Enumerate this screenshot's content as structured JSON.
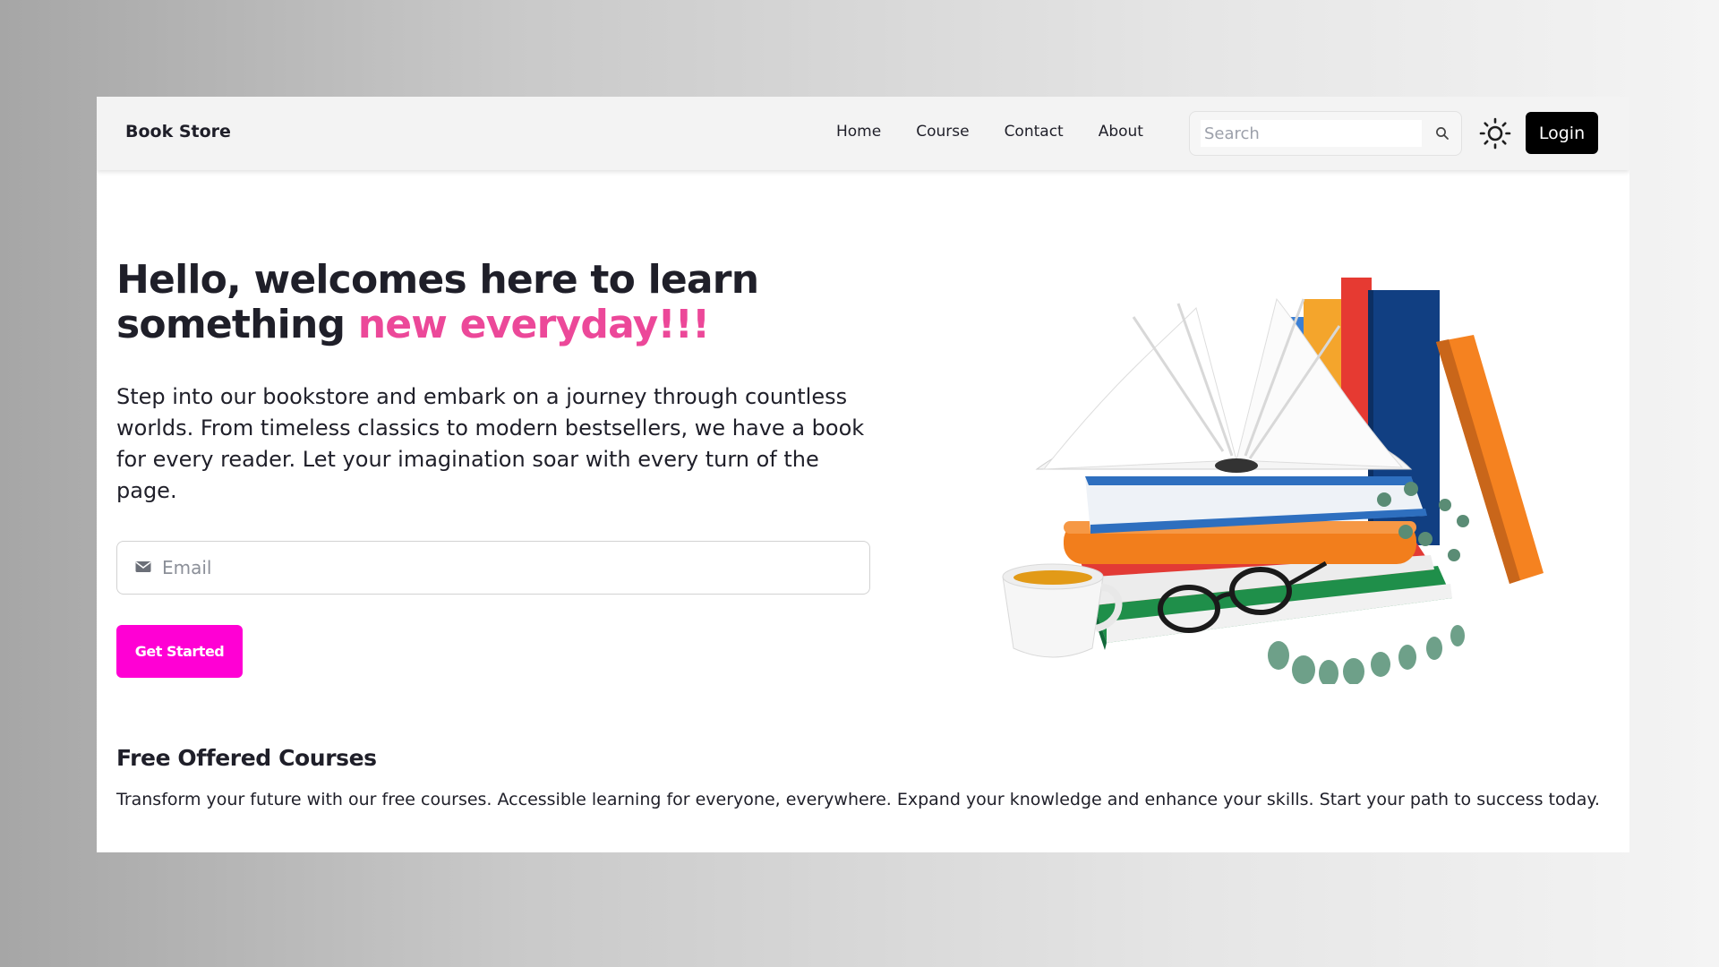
{
  "navbar": {
    "brand": "Book Store",
    "links": [
      {
        "label": "Home"
      },
      {
        "label": "Course"
      },
      {
        "label": "Contact"
      },
      {
        "label": "About"
      }
    ],
    "search": {
      "placeholder": "Search",
      "icon": "search-icon"
    },
    "theme_toggle_icon": "sun-icon",
    "login_label": "Login"
  },
  "hero": {
    "title_line1": "Hello, welcomes here to learn",
    "title_line2_prefix": "something ",
    "title_line2_accent": "new everyday!!!",
    "description": "Step into our bookstore and embark on a journey through countless worlds. From timeless classics to modern bestsellers, we have a book for every reader. Let your imagination soar with every turn of the page.",
    "email": {
      "placeholder": "Email",
      "icon": "envelope-icon"
    },
    "cta_label": "Get Started",
    "illustration": "stack-of-books-with-coffee-cup-and-glasses"
  },
  "courses": {
    "title": "Free Offered Courses",
    "description": "Transform your future with our free courses. Accessible learning for everyone, everywhere. Expand your knowledge and enhance your skills. Start your path to success today."
  },
  "colors": {
    "accent_pink": "#ec4899",
    "cta_magenta": "#ff00d4",
    "login_black": "#000000",
    "text_dark": "#1f1f29"
  }
}
